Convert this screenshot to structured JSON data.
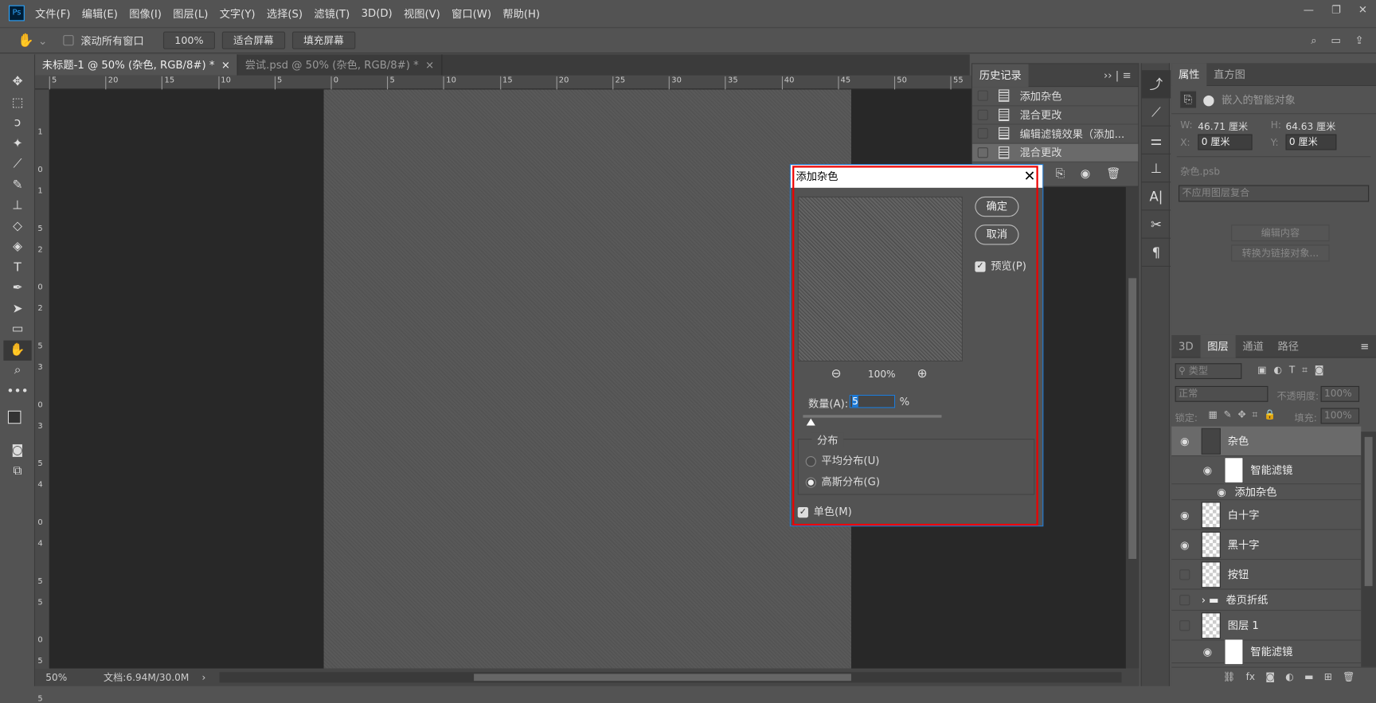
{
  "app": {
    "logo": "Ps",
    "accent": "#31a8ff"
  },
  "menu": [
    "文件(F)",
    "编辑(E)",
    "图像(I)",
    "图层(L)",
    "文字(Y)",
    "选择(S)",
    "滤镜(T)",
    "3D(D)",
    "视图(V)",
    "窗口(W)",
    "帮助(H)"
  ],
  "window_controls": {
    "minimize": "—",
    "restore": "❐",
    "close": "✕"
  },
  "options": {
    "scroll_all_label": "滚动所有窗口",
    "zoom_value": "100%",
    "fit_screen": "适合屏幕",
    "fill_screen": "填充屏幕"
  },
  "tabs": [
    {
      "label": "未标题-1 @ 50% (杂色, RGB/8#) *",
      "close": "×"
    },
    {
      "label": "尝试.psd @ 50% (杂色, RGB/8#) *",
      "close": "×"
    }
  ],
  "ruler_top": [
    "5",
    "20",
    "15",
    "10",
    "5",
    "0",
    "5",
    "10",
    "15",
    "20",
    "25",
    "30",
    "35",
    "40",
    "45",
    "50",
    "55"
  ],
  "ruler_left": [
    "1",
    "0",
    "1",
    "5",
    "2",
    "0",
    "2",
    "5",
    "3",
    "0",
    "3",
    "5",
    "4",
    "0",
    "4",
    "5",
    "5",
    "0",
    "5",
    "5"
  ],
  "status": {
    "zoom": "50%",
    "doc": "文档:6.94M/30.0M"
  },
  "history": {
    "tab": "历史记录",
    "items": [
      "添加杂色",
      "混合更改",
      "编辑滤镜效果（添加...",
      "混合更改"
    ],
    "selected": 3
  },
  "properties": {
    "tabs": [
      "属性",
      "直方图"
    ],
    "type": "嵌入的智能对象",
    "w_label": "W:",
    "w": "46.71 厘米",
    "h_label": "H:",
    "h": "64.63 厘米",
    "x_label": "X:",
    "x": "0 厘米",
    "y_label": "Y:",
    "y": "0 厘米",
    "file": "杂色.psb",
    "comp": "不应用图层复合",
    "edit_btn": "编辑内容",
    "convert_btn": "转换为链接对象..."
  },
  "layers": {
    "tabs": [
      "3D",
      "图层",
      "通道",
      "路径"
    ],
    "active_tab": 1,
    "filter": "类型",
    "blend": "正常",
    "opacity_label": "不透明度:",
    "opacity": "100%",
    "lock_label": "锁定:",
    "fill_label": "填充:",
    "fill": "100%",
    "items": [
      {
        "name": "杂色",
        "visible": true,
        "selected": true
      },
      {
        "name": "智能滤镜",
        "visible": true
      },
      {
        "name": "添加杂色",
        "visible": true
      },
      {
        "name": "白十字",
        "visible": true
      },
      {
        "name": "黑十字",
        "visible": true
      },
      {
        "name": "按钮",
        "visible": false
      },
      {
        "name": "卷页折纸",
        "visible": false
      },
      {
        "name": "图层 1",
        "visible": false
      },
      {
        "name": "智能滤镜",
        "visible": true
      }
    ]
  },
  "dialog": {
    "title": "添加杂色",
    "ok": "确定",
    "cancel": "取消",
    "preview": "预览(P)",
    "preview_checked": true,
    "zoom": "100%",
    "amount_label": "数量(A):",
    "amount": "5",
    "amount_unit": "%",
    "distribution": "分布",
    "uniform": "平均分布(U)",
    "gaussian": "高斯分布(G)",
    "gaussian_selected": true,
    "mono": "单色(M)",
    "mono_checked": true
  }
}
